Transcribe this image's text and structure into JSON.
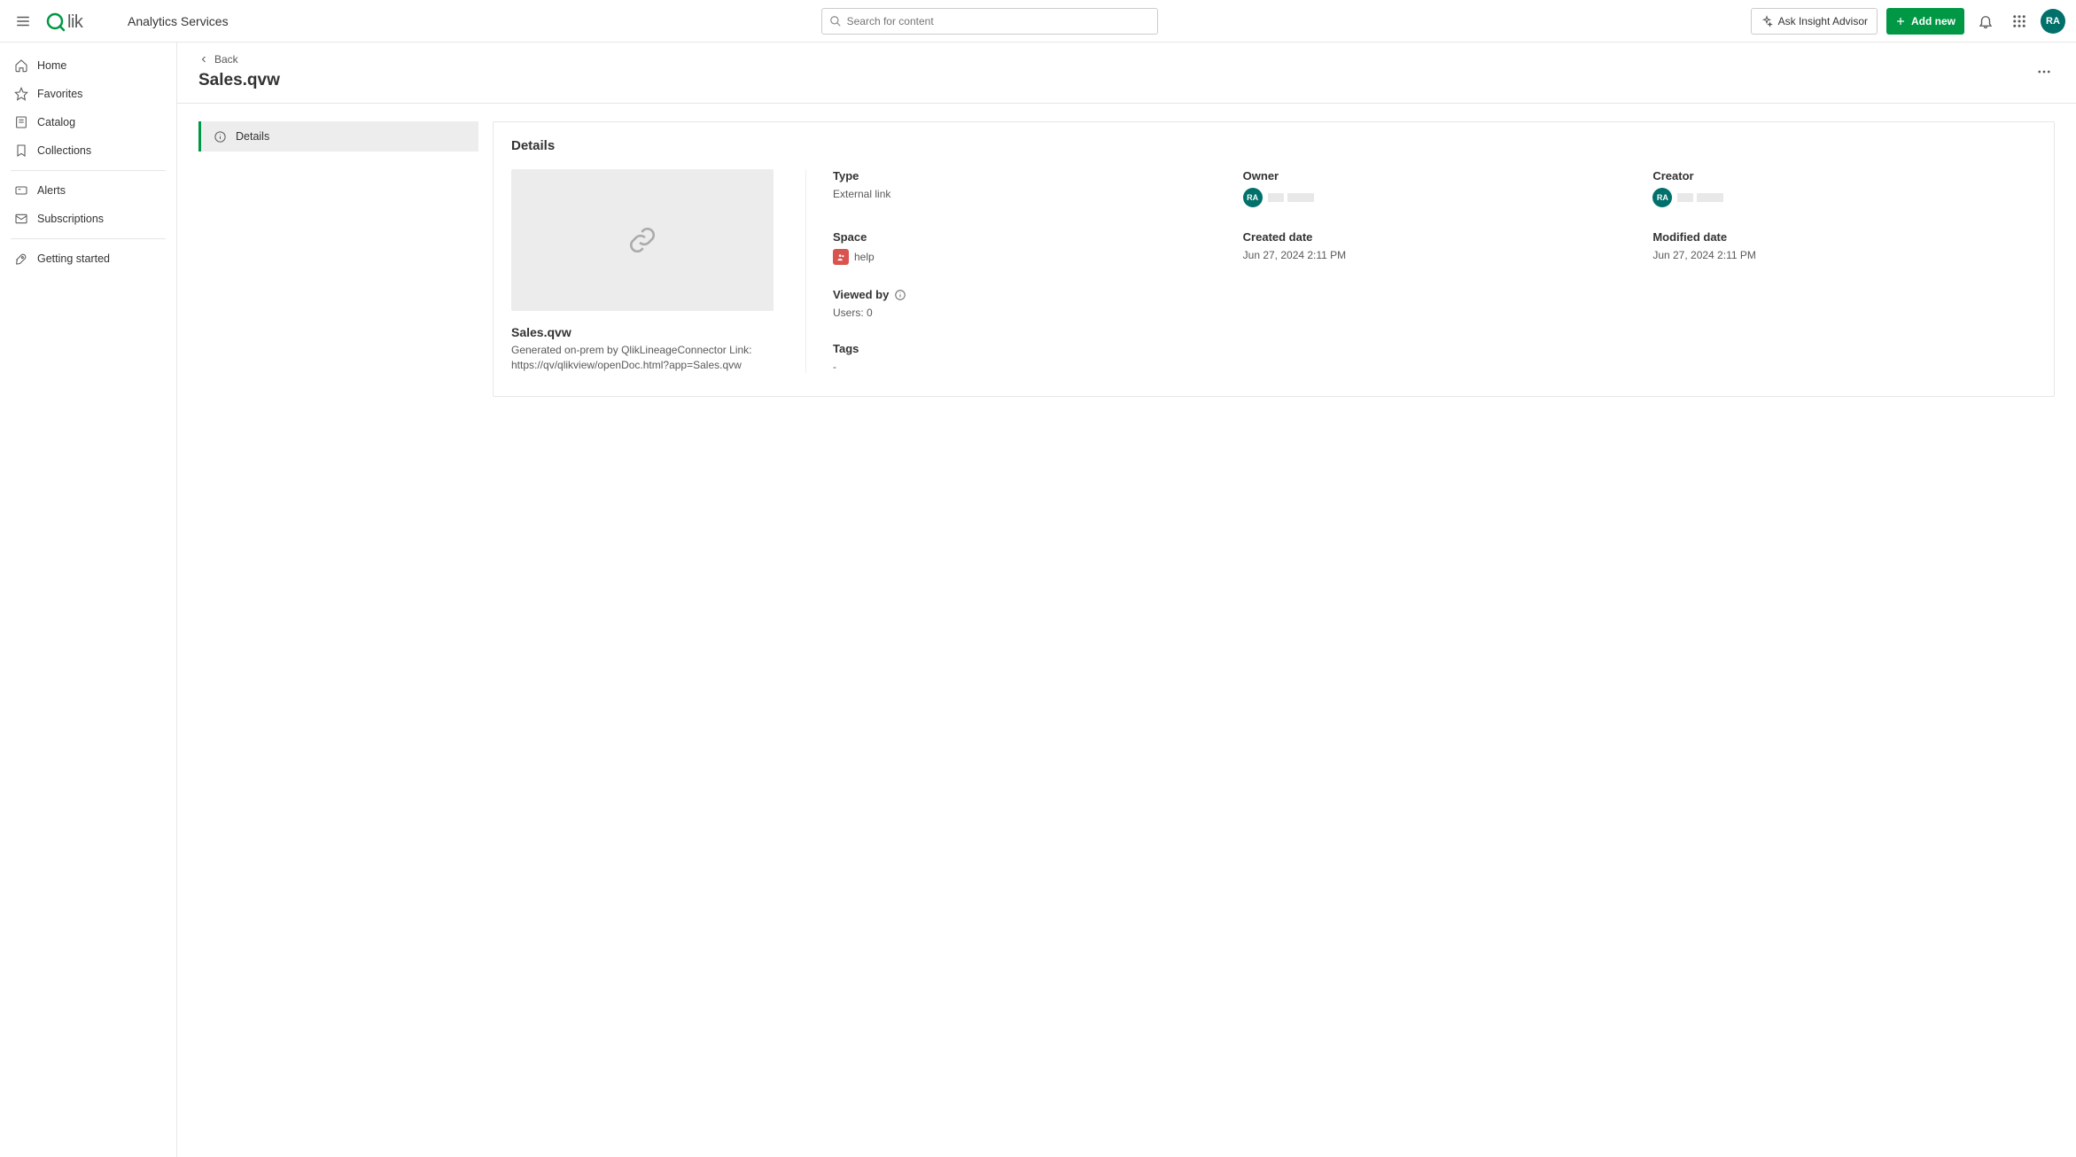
{
  "header": {
    "product": "Analytics Services",
    "search_placeholder": "Search for content",
    "ask_insight_label": "Ask Insight Advisor",
    "add_new_label": "Add new",
    "user_initials": "RA"
  },
  "sidebar": {
    "items": [
      {
        "label": "Home"
      },
      {
        "label": "Favorites"
      },
      {
        "label": "Catalog"
      },
      {
        "label": "Collections"
      },
      {
        "label": "Alerts"
      },
      {
        "label": "Subscriptions"
      },
      {
        "label": "Getting started"
      }
    ]
  },
  "page": {
    "back_label": "Back",
    "title": "Sales.qvw",
    "side_tab": "Details"
  },
  "details": {
    "panel_title": "Details",
    "item_title": "Sales.qvw",
    "item_description": "Generated on-prem by QlikLineageConnector Link: https://qv/qlikview/openDoc.html?app=Sales.qvw",
    "type_label": "Type",
    "type_value": "External link",
    "space_label": "Space",
    "space_value": "help",
    "viewed_by_label": "Viewed by",
    "viewed_by_value": "Users: 0",
    "tags_label": "Tags",
    "tags_value": "-",
    "owner_label": "Owner",
    "owner_initials": "RA",
    "creator_label": "Creator",
    "creator_initials": "RA",
    "created_date_label": "Created date",
    "created_date_value": "Jun 27, 2024 2:11 PM",
    "modified_date_label": "Modified date",
    "modified_date_value": "Jun 27, 2024 2:11 PM"
  }
}
